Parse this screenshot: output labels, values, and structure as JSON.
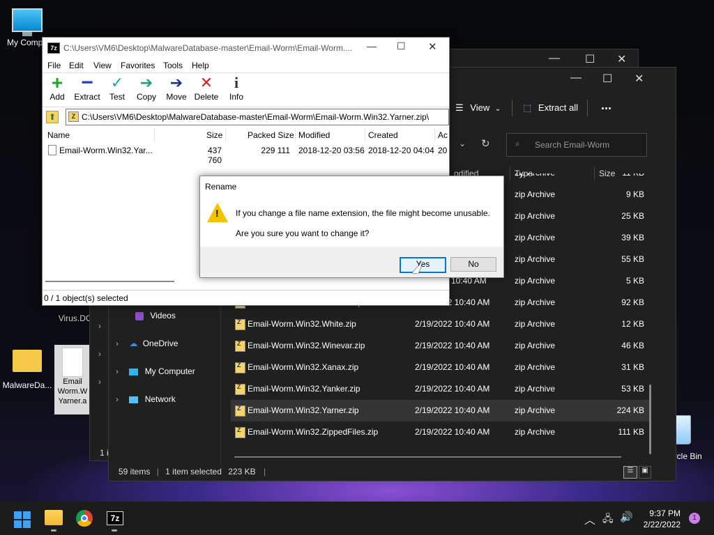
{
  "desktop": {
    "icons": {
      "my_computer": "My Compu",
      "virus_do": "Virus.DO",
      "malware_db": "MalwareDa...",
      "email_worm": "Email Worm.W Yarner.a",
      "recycle_bin": "Recycle Bin"
    }
  },
  "explorer_back": {
    "toolbar": {
      "view": "View",
      "extract_all": "Extract all",
      "more": "..."
    },
    "search_placeholder": "Search Email-Worm",
    "columns": {
      "modified": "odified",
      "type": "Type",
      "size": "Size"
    },
    "nav": {
      "videos": "Videos",
      "onedrive": "OneDrive",
      "my_computer": "My Computer",
      "network": "Network"
    },
    "rows": [
      {
        "name": "",
        "date": "",
        "type": "zip Archive",
        "size": "11 KB"
      },
      {
        "name": "",
        "date": "",
        "type": "zip Archive",
        "size": "9 KB"
      },
      {
        "name": "",
        "date": "",
        "type": "zip Archive",
        "size": "25 KB"
      },
      {
        "name": "",
        "date": "",
        "type": "zip Archive",
        "size": "39 KB"
      },
      {
        "name": "",
        "date": "",
        "type": "zip Archive",
        "size": "55 KB"
      },
      {
        "name": "",
        "date": "10:40 AM",
        "type": "zip Archive",
        "size": "5 KB"
      },
      {
        "name": "Email-Worm.Win32.Valcard.zip",
        "date": "2/19/2022 10:40 AM",
        "type": "zip Archive",
        "size": "92 KB"
      },
      {
        "name": "Email-Worm.Win32.White.zip",
        "date": "2/19/2022 10:40 AM",
        "type": "zip Archive",
        "size": "12 KB"
      },
      {
        "name": "Email-Worm.Win32.Winevar.zip",
        "date": "2/19/2022 10:40 AM",
        "type": "zip Archive",
        "size": "46 KB"
      },
      {
        "name": "Email-Worm.Win32.Xanax.zip",
        "date": "2/19/2022 10:40 AM",
        "type": "zip Archive",
        "size": "31 KB"
      },
      {
        "name": "Email-Worm.Win32.Yanker.zip",
        "date": "2/19/2022 10:40 AM",
        "type": "zip Archive",
        "size": "53 KB"
      },
      {
        "name": "Email-Worm.Win32.Yarner.zip",
        "date": "2/19/2022 10:40 AM",
        "type": "zip Archive",
        "size": "224 KB"
      },
      {
        "name": "Email-Worm.Win32.ZippedFiles.zip",
        "date": "2/19/2022 10:40 AM",
        "type": "zip Archive",
        "size": "111 KB"
      }
    ],
    "status": {
      "items": "59 items",
      "selected": "1 item selected",
      "size": "223 KB",
      "left_partial": "1 i"
    }
  },
  "sevenzip": {
    "app_icon": "7z",
    "title": "C:\\Users\\VM6\\Desktop\\MalwareDatabase-master\\Email-Worm\\Email-Worm....",
    "menu": [
      "File",
      "Edit",
      "View",
      "Favorites",
      "Tools",
      "Help"
    ],
    "toolbar": {
      "add": "Add",
      "extract": "Extract",
      "test": "Test",
      "copy": "Copy",
      "move": "Move",
      "delete": "Delete",
      "info": "Info"
    },
    "path": "C:\\Users\\VM6\\Desktop\\MalwareDatabase-master\\Email-Worm\\Email-Worm.Win32.Yarner.zip\\",
    "columns": {
      "name": "Name",
      "size": "Size",
      "packed": "Packed Size",
      "modified": "Modified",
      "created": "Created",
      "accessed": "Ac"
    },
    "row": {
      "name": "Email-Worm.Win32.Yar...",
      "size": "437 760",
      "packed": "229 111",
      "modified": "2018-12-20 03:56",
      "created": "2018-12-20 04:04",
      "accessed": "20"
    },
    "status": "0 / 1 object(s) selected"
  },
  "dialog": {
    "title": "Rename",
    "line1": "If you change a file name extension, the file might become unusable.",
    "line2": "Are you sure you want to change it?",
    "yes": "Yes",
    "no": "No"
  },
  "taskbar": {
    "time": "9:37 PM",
    "date": "2/22/2022",
    "notifications": "1",
    "sevenzip_label": "7z"
  },
  "colors": {
    "accent": "#0078d4",
    "explorer_bg": "#202020",
    "taskbar_bg": "#1c1c1c"
  }
}
